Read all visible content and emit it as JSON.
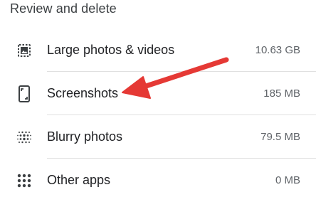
{
  "section": {
    "title": "Review and delete"
  },
  "items": [
    {
      "label": "Large photos & videos",
      "size": "10.63 GB",
      "icon": "photo-library-icon"
    },
    {
      "label": "Screenshots",
      "size": "185 MB",
      "icon": "screenshot-phone-icon"
    },
    {
      "label": "Blurry photos",
      "size": "79.5 MB",
      "icon": "blur-icon"
    },
    {
      "label": "Other apps",
      "size": "0 MB",
      "icon": "apps-grid-icon"
    }
  ],
  "colors": {
    "annotation_arrow": "#e53935",
    "text_primary": "#202124",
    "text_secondary": "#5f6368",
    "icon": "#3c4043"
  }
}
